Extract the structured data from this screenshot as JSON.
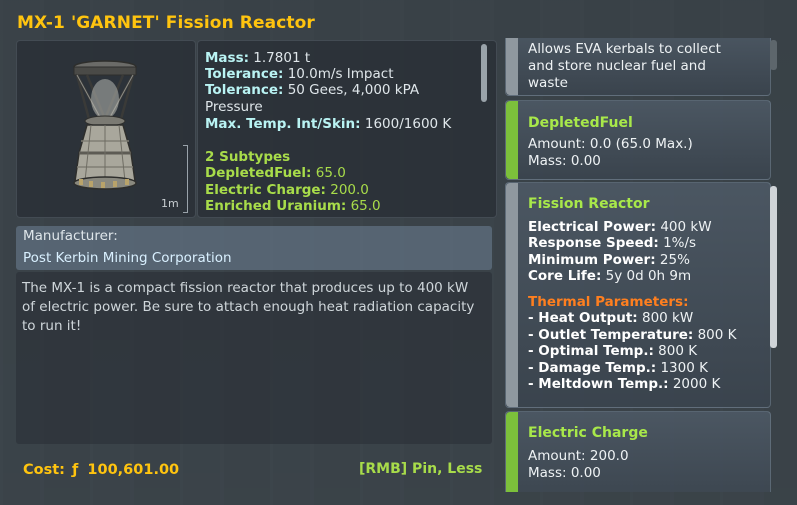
{
  "window": {
    "title": "MX-1 'GARNET' Fission Reactor"
  },
  "thumbnail": {
    "scale_label": "1m"
  },
  "stats": {
    "mass_k": "Mass:",
    "mass_v": " 1.7801 t",
    "tol1_k": "Tolerance:",
    "tol1_v": " 10.0m/s Impact",
    "tol2_k": "Tolerance:",
    "tol2_v": " 50 Gees, 4,000 kPA",
    "tol2_v2": "Pressure",
    "maxtemp_k": "Max. Temp. Int/Skin:",
    "maxtemp_v": " 1600/1600 K",
    "subtypes": "2 Subtypes",
    "depleted_k": "DepletedFuel:",
    "depleted_v": " 65.0",
    "ec_k": "Electric Charge:",
    "ec_v": " 200.0",
    "eu_k": "Enriched Uranium:",
    "eu_v": " 65.0"
  },
  "manufacturer": {
    "label": "Manufacturer:",
    "value": "Post Kerbin Mining Corporation"
  },
  "description": "The MX-1 is a compact fission reactor that produces up to 400 kW of electric power. Be sure to attach enough heat radiation capacity to run it!",
  "footer": {
    "cost_label": "Cost:",
    "cost_icon": "ƒ",
    "cost_value": "100,601.00",
    "pin_hint": "[RMB] Pin, Less"
  },
  "modules": [
    {
      "title": "",
      "lines": [
        "Allows EVA kerbals to collect",
        "and store nuclear fuel and",
        "waste"
      ]
    },
    {
      "title": "DepletedFuel",
      "amount": "Amount: 0.0 (65.0 Max.)",
      "mass": "Mass: 0.00"
    },
    {
      "title": "Fission Reactor",
      "ep_k": "Electrical Power:",
      "ep_v": " 400 kW",
      "rs_k": "Response Speed:",
      "rs_v": " 1%/s",
      "mp_k": "Minimum Power:",
      "mp_v": " 25%",
      "cl_k": "Core Life:",
      "cl_v": " 5y 0d 0h 9m",
      "thermal_title": "Thermal Parameters:",
      "ho_k": " - Heat Output:",
      "ho_v": " 800 kW",
      "ot_k": " - Outlet Temperature:",
      "ot_v": " 800 K",
      "opt_k": " - Optimal Temp.:",
      "opt_v": " 800 K",
      "dt_k": " - Damage Temp.:",
      "dt_v": " 1300 K",
      "mt_k": " - Meltdown Temp.:",
      "mt_v": " 2000 K"
    },
    {
      "title": "Electric Charge",
      "amount": "Amount: 200.0",
      "mass": "Mass: 0.00"
    }
  ],
  "colors": {
    "title": "#ffc40f",
    "green": "#a8dc4a",
    "stat_key": "#b9f3f3",
    "thermal": "#ff7f1f"
  }
}
